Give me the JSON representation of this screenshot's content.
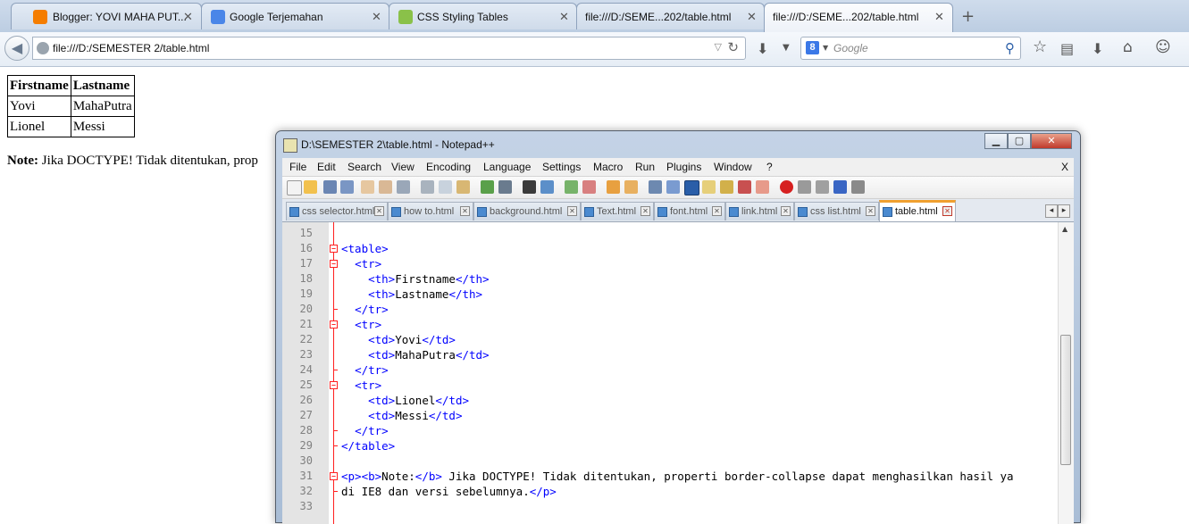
{
  "browser": {
    "tabs": [
      {
        "title": "Blogger: YOVI MAHA PUT...",
        "icon": "blogger-icon"
      },
      {
        "title": "Google Terjemahan",
        "icon": "google-translate-icon"
      },
      {
        "title": "CSS Styling Tables",
        "icon": "w3schools-icon"
      },
      {
        "title": "file:///D:/SEME...202/table.html",
        "icon": "page-icon"
      },
      {
        "title": "file:///D:/SEME...202/table.html",
        "icon": "page-icon",
        "active": true
      }
    ],
    "url": "file:///D:/SEMESTER 2/table.html",
    "search_placeholder": "Google",
    "search_engine_letter": "8"
  },
  "page": {
    "table": {
      "headers": [
        "Firstname",
        "Lastname"
      ],
      "rows": [
        [
          "Yovi",
          "MahaPutra"
        ],
        [
          "Lionel",
          "Messi"
        ]
      ]
    },
    "note_bold": "Note:",
    "note_text": " Jika DOCTYPE! Tidak ditentukan, prop"
  },
  "notepad": {
    "title": "D:\\SEMESTER 2\\table.html - Notepad++",
    "menu": [
      "File",
      "Edit",
      "Search",
      "View",
      "Encoding",
      "Language",
      "Settings",
      "Macro",
      "Run",
      "Plugins",
      "Window",
      "?"
    ],
    "menu_close": "X",
    "doc_tabs": [
      "css selector.html",
      "how to.html",
      "background.html",
      "Text.html",
      "font.html",
      "link.html",
      "css list.html",
      "table.html"
    ],
    "active_tab": "table.html",
    "code_lines": [
      {
        "n": "15",
        "code": ""
      },
      {
        "n": "16",
        "code": "<table>"
      },
      {
        "n": "17",
        "code": "  <tr>"
      },
      {
        "n": "18",
        "code": "    <th>Firstname</th>"
      },
      {
        "n": "19",
        "code": "    <th>Lastname</th>"
      },
      {
        "n": "20",
        "code": "  </tr>"
      },
      {
        "n": "21",
        "code": "  <tr>"
      },
      {
        "n": "22",
        "code": "    <td>Yovi</td>"
      },
      {
        "n": "23",
        "code": "    <td>MahaPutra</td>"
      },
      {
        "n": "24",
        "code": "  </tr>"
      },
      {
        "n": "25",
        "code": "  <tr>"
      },
      {
        "n": "26",
        "code": "    <td>Lionel</td>"
      },
      {
        "n": "27",
        "code": "    <td>Messi</td>"
      },
      {
        "n": "28",
        "code": "  </tr>"
      },
      {
        "n": "29",
        "code": "</table>"
      },
      {
        "n": "30",
        "code": ""
      },
      {
        "n": "31",
        "code": "<p><b>Note:</b> Jika DOCTYPE! Tidak ditentukan, properti border-collapse dapat menghasilkan hasil ya"
      },
      {
        "n": "32",
        "code": "di IE8 dan versi sebelumnya.</p>"
      },
      {
        "n": "33",
        "code": ""
      }
    ],
    "fold_open_lines": [
      "16",
      "17",
      "21",
      "25",
      "31"
    ],
    "fold_end_lines": [
      "20",
      "24",
      "28",
      "29",
      "32"
    ]
  },
  "colors": {
    "tag": "#0000ff",
    "text": "#000000",
    "line_number": "#808080",
    "fold_marker": "#ff2020",
    "active_tab_accent": "#f0a030"
  }
}
